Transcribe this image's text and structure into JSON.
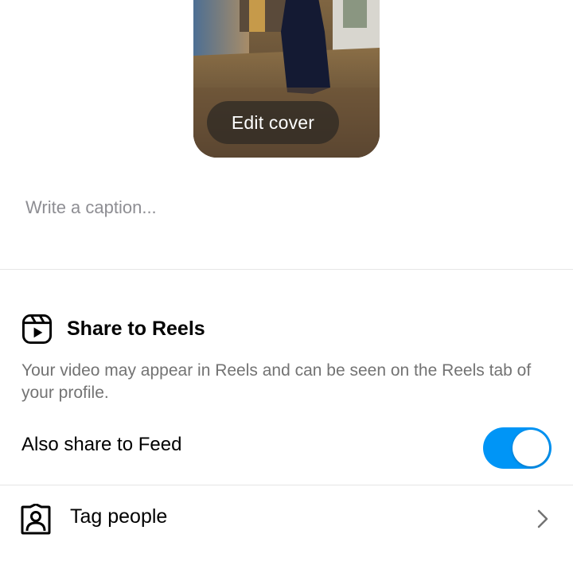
{
  "cover": {
    "edit_label": "Edit cover"
  },
  "caption": {
    "placeholder": "Write a caption...",
    "value": ""
  },
  "reels": {
    "title": "Share to Reels",
    "description": "Your video may appear in Reels and can be seen on the Reels tab of your profile.",
    "icon": "reels-icon"
  },
  "feed": {
    "label": "Also share to Feed",
    "enabled": true,
    "toggle_color": "#0095f6"
  },
  "tag_people": {
    "label": "Tag people",
    "icon": "tag-people-icon"
  }
}
